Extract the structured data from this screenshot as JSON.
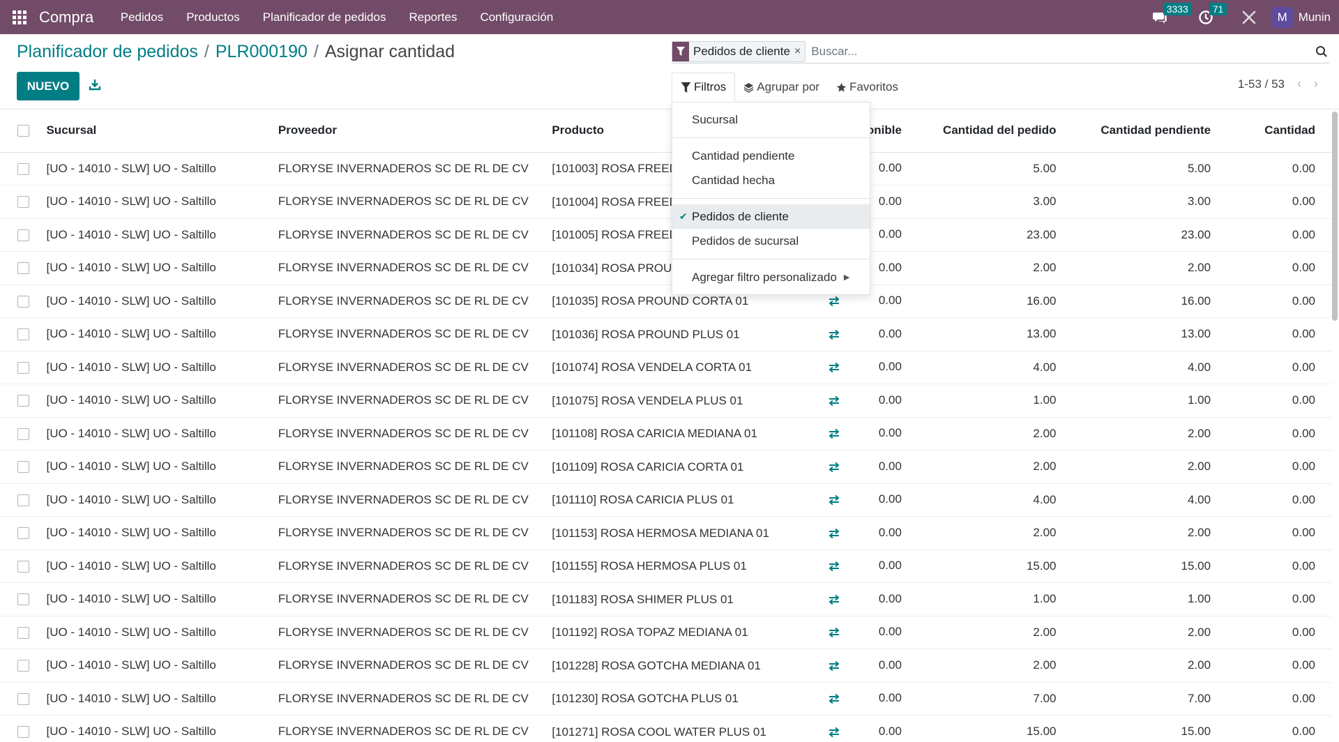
{
  "navbar": {
    "app_name": "Compra",
    "menu": [
      "Pedidos",
      "Productos",
      "Planificador de pedidos",
      "Reportes",
      "Configuración"
    ],
    "messages_count": "3333",
    "activities_count": "71",
    "avatar_letter": "M",
    "user_name": "Munin"
  },
  "breadcrumb": {
    "root": "Planificador de pedidos",
    "record": "PLR000190",
    "current": "Asignar cantidad",
    "separator": "/"
  },
  "actions": {
    "new_label": "NUEVO"
  },
  "search": {
    "facet_label": "Pedidos de cliente",
    "facet_remove": "×",
    "placeholder": "Buscar..."
  },
  "search_panel": {
    "filters": "Filtros",
    "group_by": "Agrupar por",
    "favorites": "Favoritos"
  },
  "pager": {
    "value": "1-53 / 53",
    "prev": "‹",
    "next": "›"
  },
  "filters_dropdown": {
    "items_group1": [
      "Sucursal"
    ],
    "items_group2": [
      "Cantidad pendiente",
      "Cantidad hecha"
    ],
    "items_group3": [
      {
        "label": "Pedidos de cliente",
        "checked": true
      },
      {
        "label": "Pedidos de sucursal",
        "checked": false
      }
    ],
    "custom_filter": "Agregar filtro personalizado",
    "check_glyph": "✔",
    "caret_glyph": "▶"
  },
  "table": {
    "columns": [
      "Sucursal",
      "Proveedor",
      "Producto",
      "Disponible",
      "Cantidad del pedido",
      "Cantidad pendiente",
      "Cantidad"
    ],
    "rows": [
      {
        "sucursal": "[UO - 14010 - SLW] UO - Saltillo",
        "proveedor": "FLORYSE INVERNADEROS SC DE RL DE CV",
        "producto": "[101003] ROSA FREEDOM",
        "disponible": "0.00",
        "pedido": "5.00",
        "pendiente": "5.00",
        "cantidad": "0.00"
      },
      {
        "sucursal": "[UO - 14010 - SLW] UO - Saltillo",
        "proveedor": "FLORYSE INVERNADEROS SC DE RL DE CV",
        "producto": "[101004] ROSA FREEDOM",
        "disponible": "0.00",
        "pedido": "3.00",
        "pendiente": "3.00",
        "cantidad": "0.00"
      },
      {
        "sucursal": "[UO - 14010 - SLW] UO - Saltillo",
        "proveedor": "FLORYSE INVERNADEROS SC DE RL DE CV",
        "producto": "[101005] ROSA FREEDOM",
        "disponible": "0.00",
        "pedido": "23.00",
        "pendiente": "23.00",
        "cantidad": "0.00"
      },
      {
        "sucursal": "[UO - 14010 - SLW] UO - Saltillo",
        "proveedor": "FLORYSE INVERNADEROS SC DE RL DE CV",
        "producto": "[101034] ROSA PROUND",
        "disponible": "0.00",
        "pedido": "2.00",
        "pendiente": "2.00",
        "cantidad": "0.00"
      },
      {
        "sucursal": "[UO - 14010 - SLW] UO - Saltillo",
        "proveedor": "FLORYSE INVERNADEROS SC DE RL DE CV",
        "producto": "[101035] ROSA PROUND CORTA 01",
        "disponible": "0.00",
        "pedido": "16.00",
        "pendiente": "16.00",
        "cantidad": "0.00"
      },
      {
        "sucursal": "[UO - 14010 - SLW] UO - Saltillo",
        "proveedor": "FLORYSE INVERNADEROS SC DE RL DE CV",
        "producto": "[101036] ROSA PROUND PLUS 01",
        "disponible": "0.00",
        "pedido": "13.00",
        "pendiente": "13.00",
        "cantidad": "0.00"
      },
      {
        "sucursal": "[UO - 14010 - SLW] UO - Saltillo",
        "proveedor": "FLORYSE INVERNADEROS SC DE RL DE CV",
        "producto": "[101074] ROSA VENDELA CORTA 01",
        "disponible": "0.00",
        "pedido": "4.00",
        "pendiente": "4.00",
        "cantidad": "0.00"
      },
      {
        "sucursal": "[UO - 14010 - SLW] UO - Saltillo",
        "proveedor": "FLORYSE INVERNADEROS SC DE RL DE CV",
        "producto": "[101075] ROSA VENDELA PLUS 01",
        "disponible": "0.00",
        "pedido": "1.00",
        "pendiente": "1.00",
        "cantidad": "0.00"
      },
      {
        "sucursal": "[UO - 14010 - SLW] UO - Saltillo",
        "proveedor": "FLORYSE INVERNADEROS SC DE RL DE CV",
        "producto": "[101108] ROSA CARICIA MEDIANA 01",
        "disponible": "0.00",
        "pedido": "2.00",
        "pendiente": "2.00",
        "cantidad": "0.00"
      },
      {
        "sucursal": "[UO - 14010 - SLW] UO - Saltillo",
        "proveedor": "FLORYSE INVERNADEROS SC DE RL DE CV",
        "producto": "[101109] ROSA CARICIA CORTA 01",
        "disponible": "0.00",
        "pedido": "2.00",
        "pendiente": "2.00",
        "cantidad": "0.00"
      },
      {
        "sucursal": "[UO - 14010 - SLW] UO - Saltillo",
        "proveedor": "FLORYSE INVERNADEROS SC DE RL DE CV",
        "producto": "[101110] ROSA CARICIA PLUS 01",
        "disponible": "0.00",
        "pedido": "4.00",
        "pendiente": "4.00",
        "cantidad": "0.00"
      },
      {
        "sucursal": "[UO - 14010 - SLW] UO - Saltillo",
        "proveedor": "FLORYSE INVERNADEROS SC DE RL DE CV",
        "producto": "[101153] ROSA HERMOSA MEDIANA 01",
        "disponible": "0.00",
        "pedido": "2.00",
        "pendiente": "2.00",
        "cantidad": "0.00"
      },
      {
        "sucursal": "[UO - 14010 - SLW] UO - Saltillo",
        "proveedor": "FLORYSE INVERNADEROS SC DE RL DE CV",
        "producto": "[101155] ROSA HERMOSA PLUS 01",
        "disponible": "0.00",
        "pedido": "15.00",
        "pendiente": "15.00",
        "cantidad": "0.00"
      },
      {
        "sucursal": "[UO - 14010 - SLW] UO - Saltillo",
        "proveedor": "FLORYSE INVERNADEROS SC DE RL DE CV",
        "producto": "[101183] ROSA SHIMER PLUS 01",
        "disponible": "0.00",
        "pedido": "1.00",
        "pendiente": "1.00",
        "cantidad": "0.00"
      },
      {
        "sucursal": "[UO - 14010 - SLW] UO - Saltillo",
        "proveedor": "FLORYSE INVERNADEROS SC DE RL DE CV",
        "producto": "[101192] ROSA TOPAZ MEDIANA 01",
        "disponible": "0.00",
        "pedido": "2.00",
        "pendiente": "2.00",
        "cantidad": "0.00"
      },
      {
        "sucursal": "[UO - 14010 - SLW] UO - Saltillo",
        "proveedor": "FLORYSE INVERNADEROS SC DE RL DE CV",
        "producto": "[101228] ROSA GOTCHA MEDIANA 01",
        "disponible": "0.00",
        "pedido": "2.00",
        "pendiente": "2.00",
        "cantidad": "0.00"
      },
      {
        "sucursal": "[UO - 14010 - SLW] UO - Saltillo",
        "proveedor": "FLORYSE INVERNADEROS SC DE RL DE CV",
        "producto": "[101230] ROSA GOTCHA PLUS 01",
        "disponible": "0.00",
        "pedido": "7.00",
        "pendiente": "7.00",
        "cantidad": "0.00"
      },
      {
        "sucursal": "[UO - 14010 - SLW] UO - Saltillo",
        "proveedor": "FLORYSE INVERNADEROS SC DE RL DE CV",
        "producto": "[101271] ROSA COOL WATER PLUS 01",
        "disponible": "0.00",
        "pedido": "15.00",
        "pendiente": "15.00",
        "cantidad": "0.00"
      }
    ]
  },
  "colors": {
    "brand": "#714b67",
    "accent": "#017e84"
  }
}
